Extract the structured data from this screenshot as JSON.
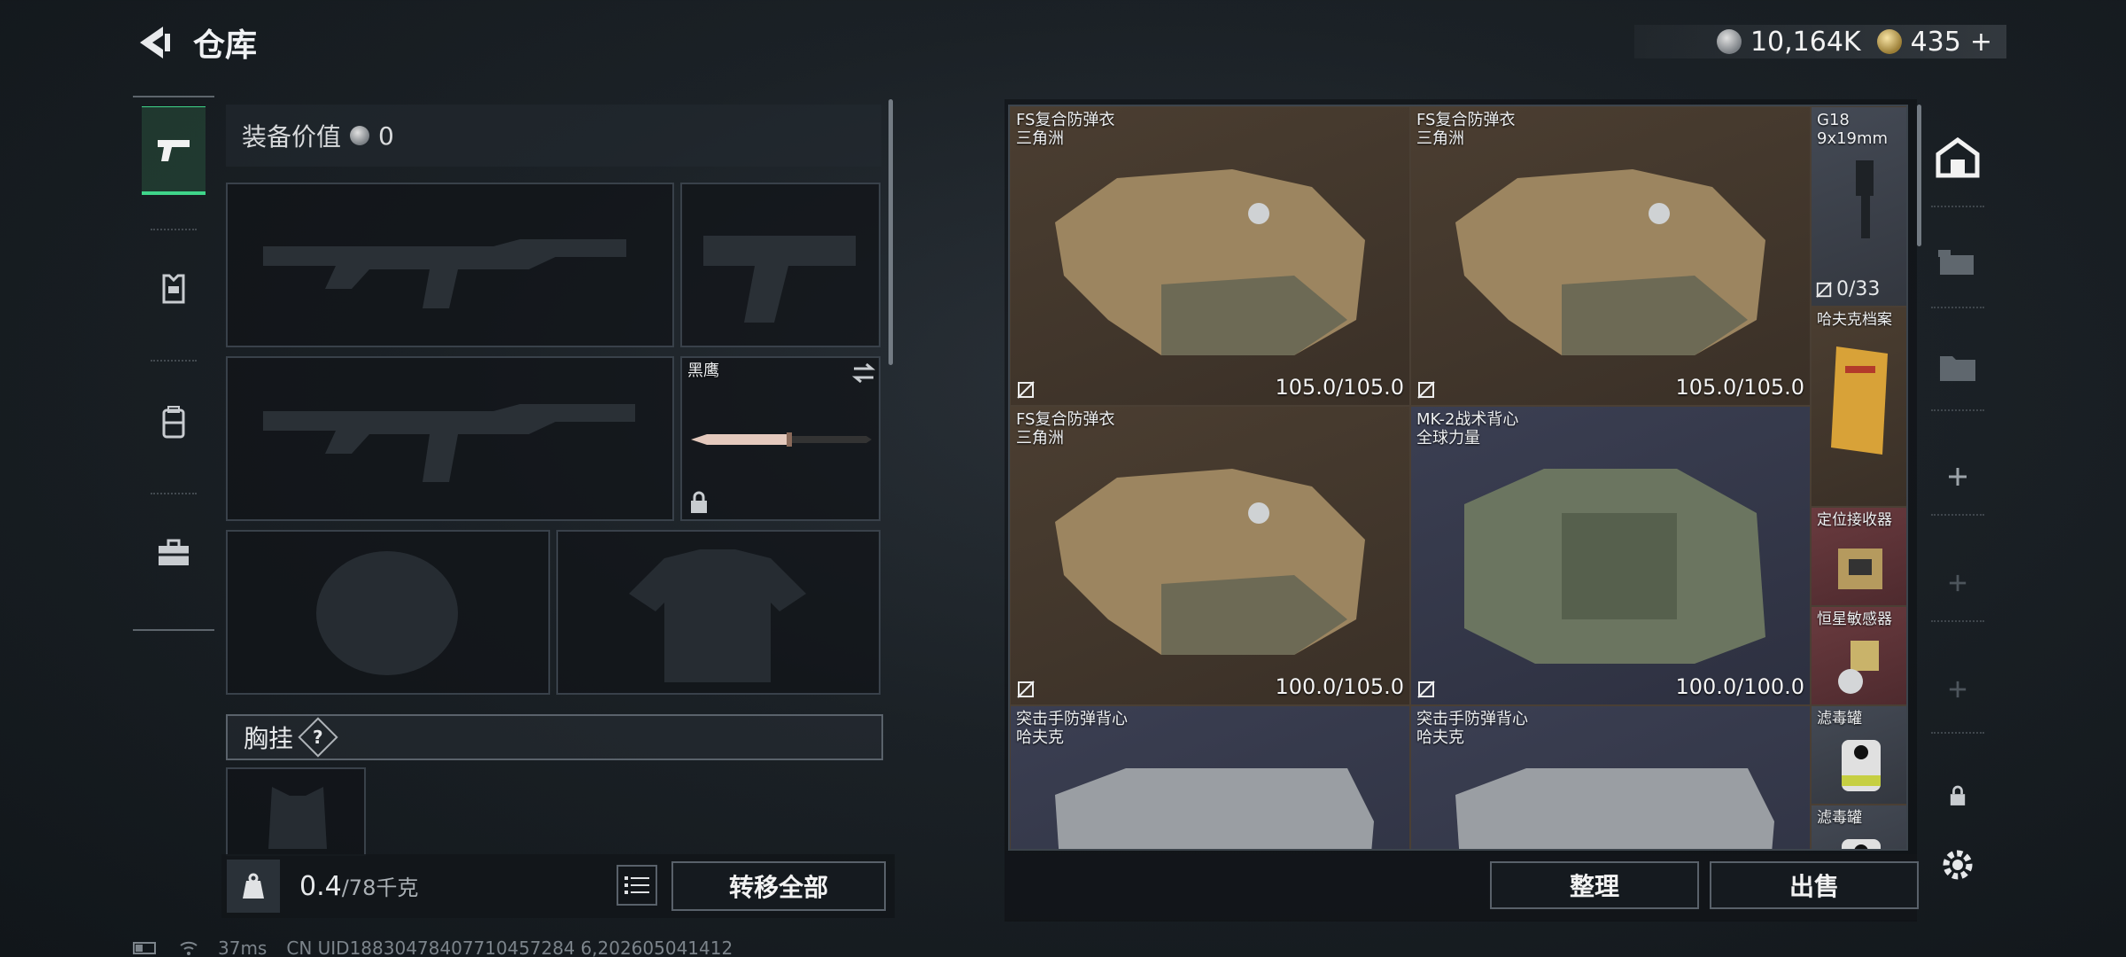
{
  "header": {
    "title": "仓库",
    "silver": "10,164K",
    "gold": "435",
    "add": "+"
  },
  "equipment": {
    "value_label": "装备价值",
    "value": "0",
    "melee_name": "黑鹰",
    "chest_label": "胸挂",
    "help": "?",
    "weight": "0.4",
    "weight_max": "/78千克",
    "transfer_all": "转移全部"
  },
  "inventory": {
    "items": [
      {
        "name": "FS复合防弹衣",
        "sub": "三角洲",
        "durability": "105.0/105.0"
      },
      {
        "name": "FS复合防弹衣",
        "sub": "三角洲",
        "durability": "105.0/105.0"
      },
      {
        "name": "FS复合防弹衣",
        "sub": "三角洲",
        "durability": "100.0/105.0"
      },
      {
        "name": "MK-2战术背心",
        "sub": "全球力量",
        "durability": "100.0/100.0"
      },
      {
        "name": "突击手防弹背心",
        "sub": "哈夫克"
      },
      {
        "name": "突击手防弹背心",
        "sub": "哈夫克"
      }
    ],
    "small_items": [
      {
        "name": "G18",
        "sub": "9x19mm",
        "ammo": "0/33"
      },
      {
        "name": "哈夫克档案"
      },
      {
        "name": "定位接收器"
      },
      {
        "name": "恒星敏感器"
      },
      {
        "name": "滤毒罐"
      },
      {
        "name": "滤毒罐"
      }
    ],
    "sort": "整理",
    "sell": "出售"
  },
  "status": {
    "ping": "37ms",
    "uid": "CN UID18830478407710457284 6,202605041412"
  },
  "colors": {
    "accent_green": "#3fd58a",
    "brown_cell": "#4b3e31",
    "red_cell": "#6a3b3f"
  }
}
